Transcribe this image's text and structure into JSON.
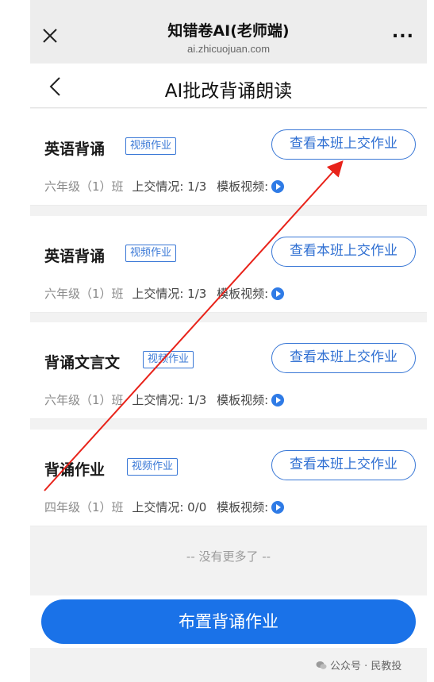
{
  "browser": {
    "title": "知错卷AI(老师端)",
    "url": "ai.zhicuojuan.com",
    "more": "..."
  },
  "header": {
    "title": "AI批改背诵朗读"
  },
  "cards": [
    {
      "name": "英语背诵",
      "tag": "视频作业",
      "button": "查看本班上交作业",
      "class": "六年级（1）班",
      "status_label": "上交情况: ",
      "status_value": "1/3",
      "template_label": "模板视频:"
    },
    {
      "name": "英语背诵",
      "tag": "视频作业",
      "button": "查看本班上交作业",
      "class": "六年级（1）班",
      "status_label": "上交情况: ",
      "status_value": "1/3",
      "template_label": "模板视频:"
    },
    {
      "name": "背诵文言文",
      "tag": "视频作业",
      "button": "查看本班上交作业",
      "class": "六年级（1）班",
      "status_label": "上交情况: ",
      "status_value": "1/3",
      "template_label": "模板视频:"
    },
    {
      "name": "背诵作业",
      "tag": "视频作业",
      "button": "查看本班上交作业",
      "class": "四年级（1）班",
      "status_label": "上交情况: ",
      "status_value": "0/0",
      "template_label": "模板视频:"
    }
  ],
  "footer": {
    "no_more": "-- 没有更多了 --",
    "assign_button": "布置背诵作业",
    "watermark": "公众号 · 民教投"
  },
  "colors": {
    "accent": "#1a72e8",
    "tag_blue": "#3a78d6",
    "annotation_arrow": "#e8231a"
  },
  "icons": {
    "close": "close-icon",
    "more": "more-icon",
    "back": "back-arrow-icon",
    "play": "play-icon",
    "wechat": "wechat-icon"
  }
}
